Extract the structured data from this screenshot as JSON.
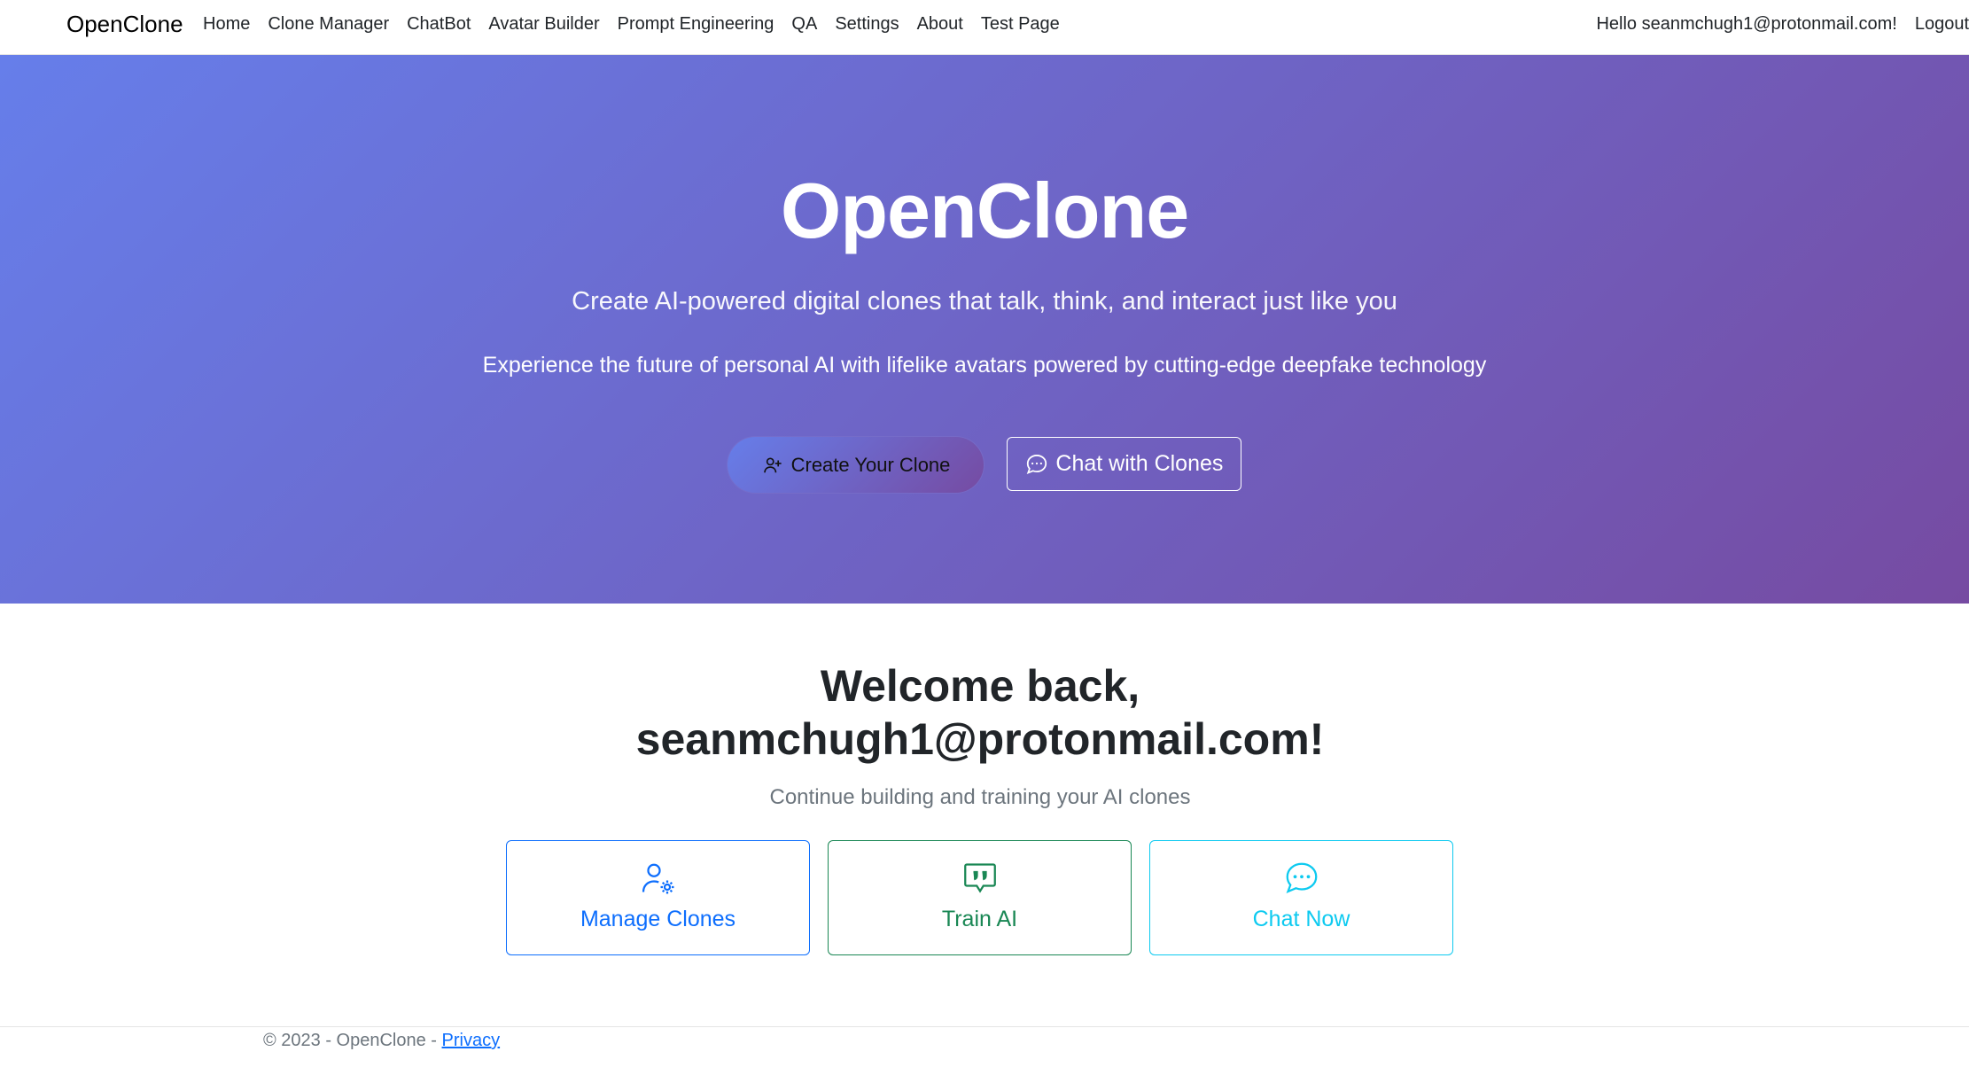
{
  "navbar": {
    "brand": "OpenClone",
    "links": [
      "Home",
      "Clone Manager",
      "ChatBot",
      "Avatar Builder",
      "Prompt Engineering",
      "QA",
      "Settings",
      "About",
      "Test Page"
    ],
    "greeting": "Hello seanmchugh1@protonmail.com!",
    "logout": "Logout"
  },
  "hero": {
    "title": "OpenClone",
    "lead": "Create AI-powered digital clones that talk, think, and interact just like you",
    "sub": "Experience the future of personal AI with lifelike avatars powered by cutting-edge deepfake technology",
    "primary_button": "Create Your Clone",
    "primary_icon": "person-add-icon",
    "secondary_button": "Chat with Clones",
    "secondary_icon": "chat-dots-icon"
  },
  "welcome": {
    "line1": "Welcome back,",
    "line2": "seanmchugh1@protonmail.com!",
    "subtitle": "Continue building and training your AI clones"
  },
  "cards": [
    {
      "label": "Manage Clones",
      "icon": "person-gear-icon",
      "color": "#0d6efd"
    },
    {
      "label": "Train AI",
      "icon": "chat-quote-icon",
      "color": "#198754"
    },
    {
      "label": "Chat Now",
      "icon": "chat-dots-icon",
      "color": "#0dcaf0"
    }
  ],
  "footer": {
    "text": "© 2023 - OpenClone - ",
    "privacy": "Privacy"
  },
  "colors": {
    "hero_gradient_start": "#667eea",
    "hero_gradient_end": "#764ba2"
  }
}
